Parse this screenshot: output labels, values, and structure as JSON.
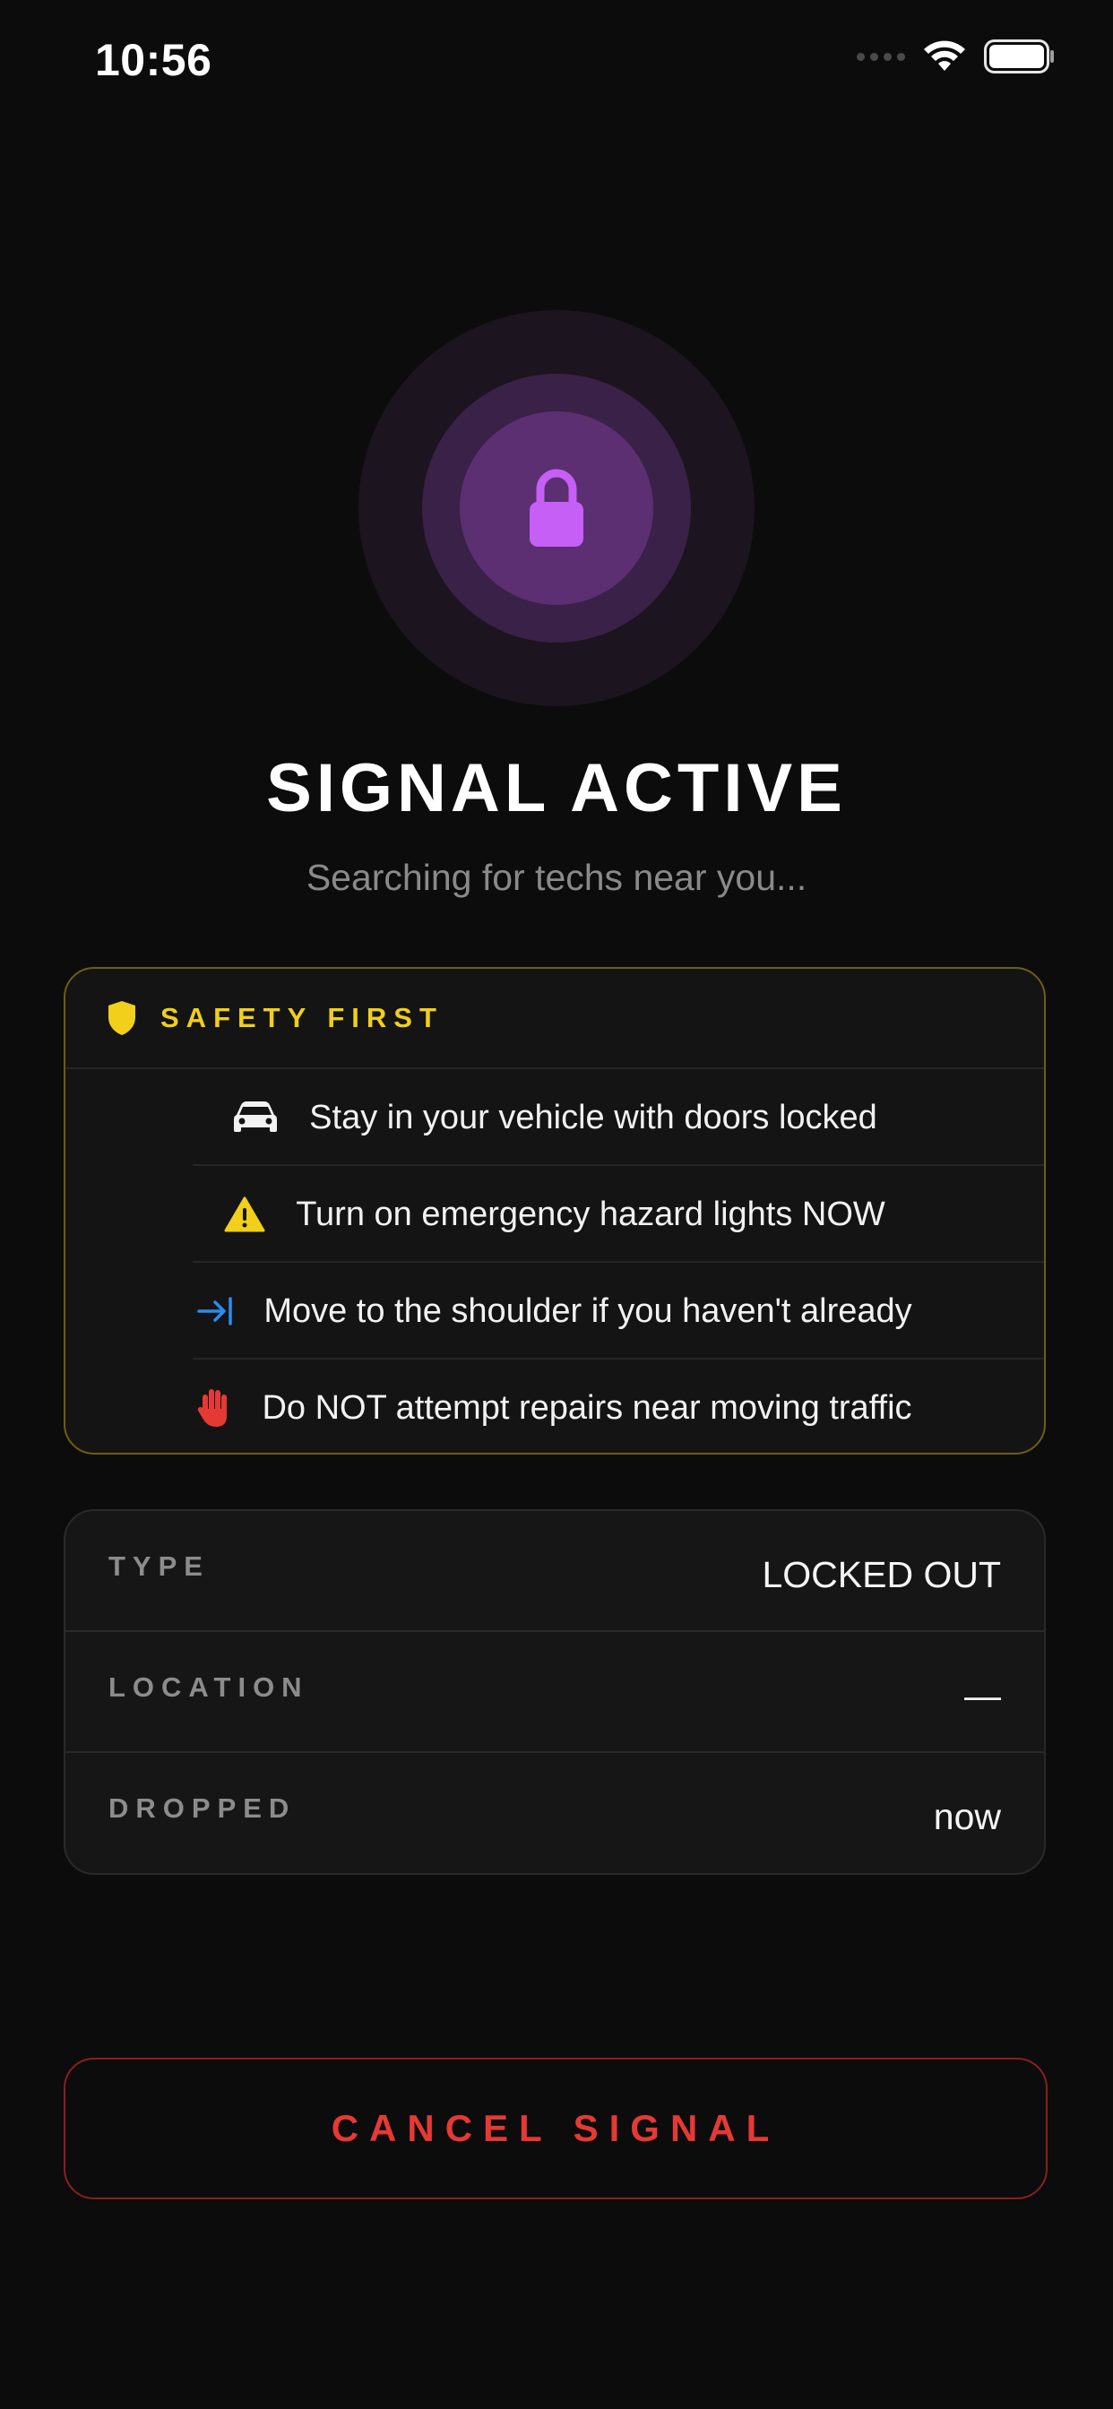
{
  "status_bar": {
    "time": "10:56"
  },
  "hero": {
    "icon": "lock-icon",
    "title": "SIGNAL ACTIVE",
    "subtitle": "Searching for techs near you..."
  },
  "safety": {
    "header_icon": "shield-icon",
    "header_label": "SAFETY FIRST",
    "tips": [
      {
        "icon": "car-icon",
        "text": "Stay in your vehicle with doors locked"
      },
      {
        "icon": "warning-icon",
        "text": "Turn on emergency hazard lights NOW"
      },
      {
        "icon": "arrow-right-to-line-icon",
        "text": "Move to the shoulder if you haven't already"
      },
      {
        "icon": "hand-stop-icon",
        "text": "Do NOT attempt repairs near moving traffic"
      }
    ]
  },
  "details": {
    "rows": [
      {
        "label": "TYPE",
        "value": "LOCKED OUT"
      },
      {
        "label": "LOCATION",
        "value": "—"
      },
      {
        "label": "DROPPED",
        "value": "now"
      }
    ]
  },
  "cancel_button": {
    "label": "CANCEL SIGNAL"
  },
  "colors": {
    "background": "#0c0c0c",
    "accent_purple": "#c55ff5",
    "safety_yellow": "#f1cf1a",
    "danger_red": "#e53935",
    "info_blue": "#2d8cf0"
  }
}
